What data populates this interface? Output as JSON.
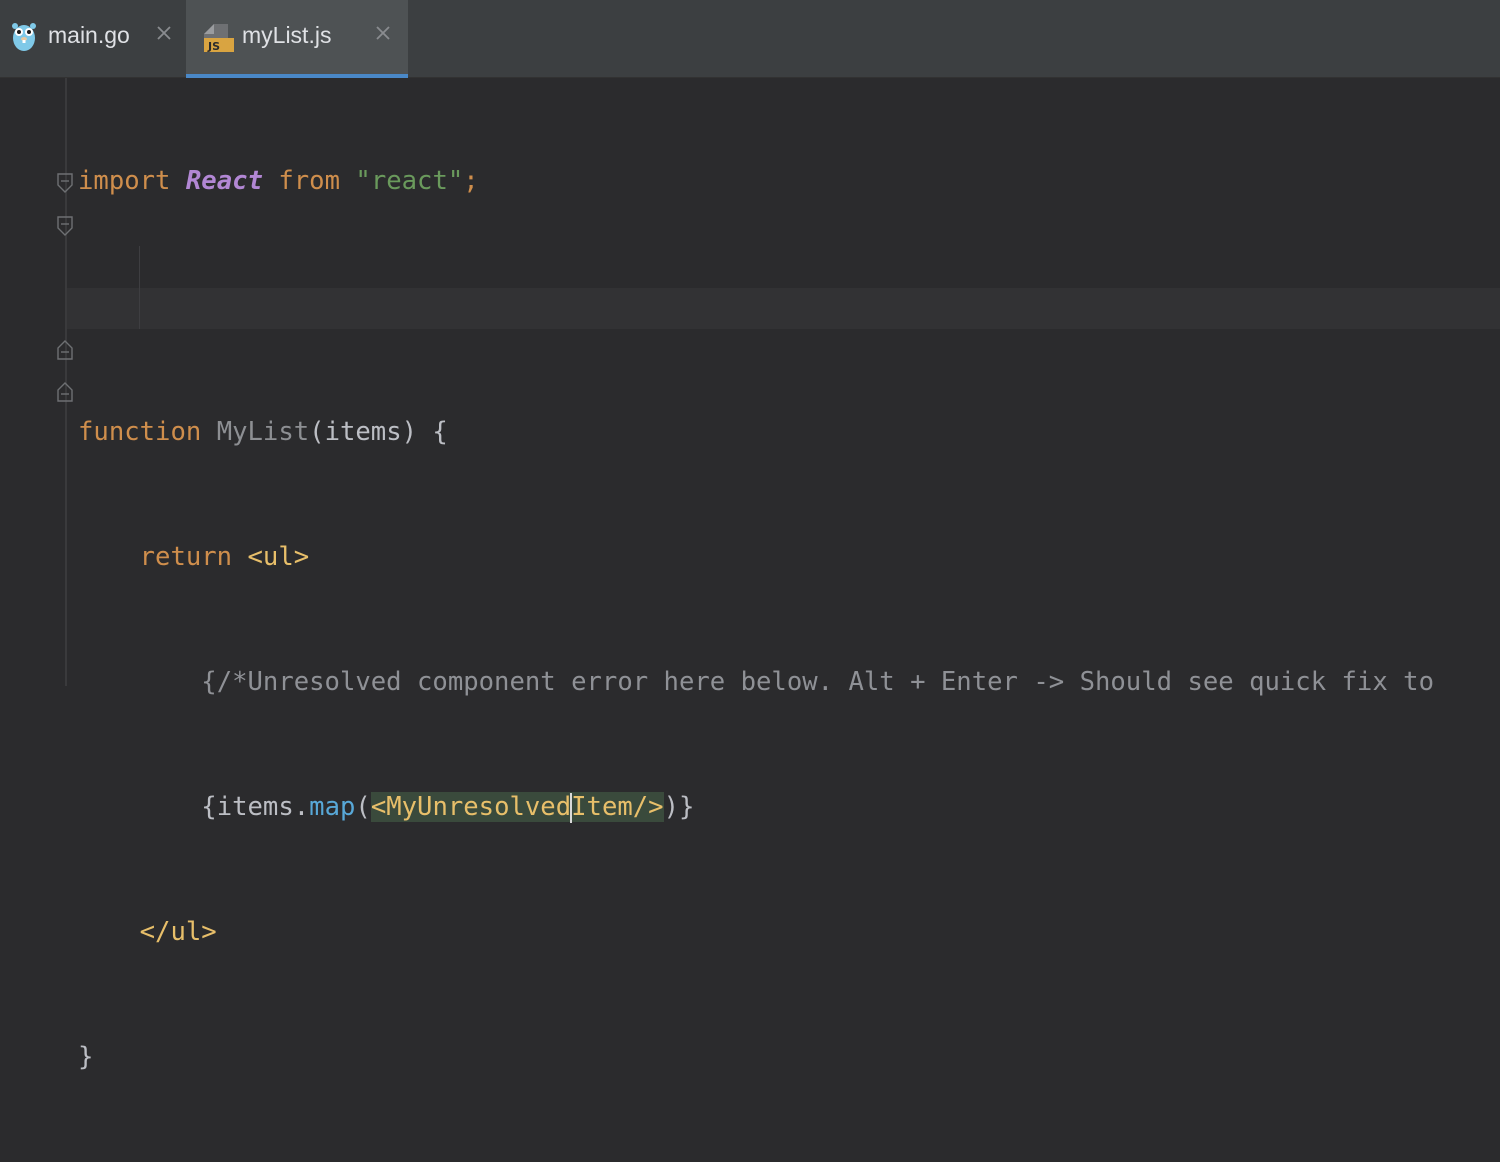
{
  "tabs": [
    {
      "label": "main.go",
      "icon": "gopher-icon",
      "active": false
    },
    {
      "label": "myList.js",
      "icon": "js-file-icon",
      "active": true,
      "icon_text": "JS"
    }
  ],
  "colors": {
    "keyword": "#cf8e4c",
    "string": "#6a9a5c",
    "tag": "#e8bf6a",
    "react": "#b287d4",
    "active_tab_underline": "#4a88c7"
  },
  "code": {
    "line1": {
      "kw_import": "import",
      "react": "React",
      "kw_from": "from",
      "string": "\"react\"",
      "semi": ";"
    },
    "line3": {
      "kw_function": "function",
      "name": "MyList",
      "params": "(items) {"
    },
    "line4": {
      "kw_return": "return",
      "tag": "<ul>"
    },
    "line5": {
      "comment": "{/*Unresolved component error here below. Alt + Enter -> Should see quick fix to"
    },
    "line6": {
      "prefix": "{items.",
      "fn": "map",
      "open": "(",
      "tag_a": "<MyUnresolved",
      "tag_b": "Item/>",
      "close": ")}"
    },
    "line7": {
      "tag": "</ul>"
    },
    "line8": {
      "brace": "}"
    }
  }
}
